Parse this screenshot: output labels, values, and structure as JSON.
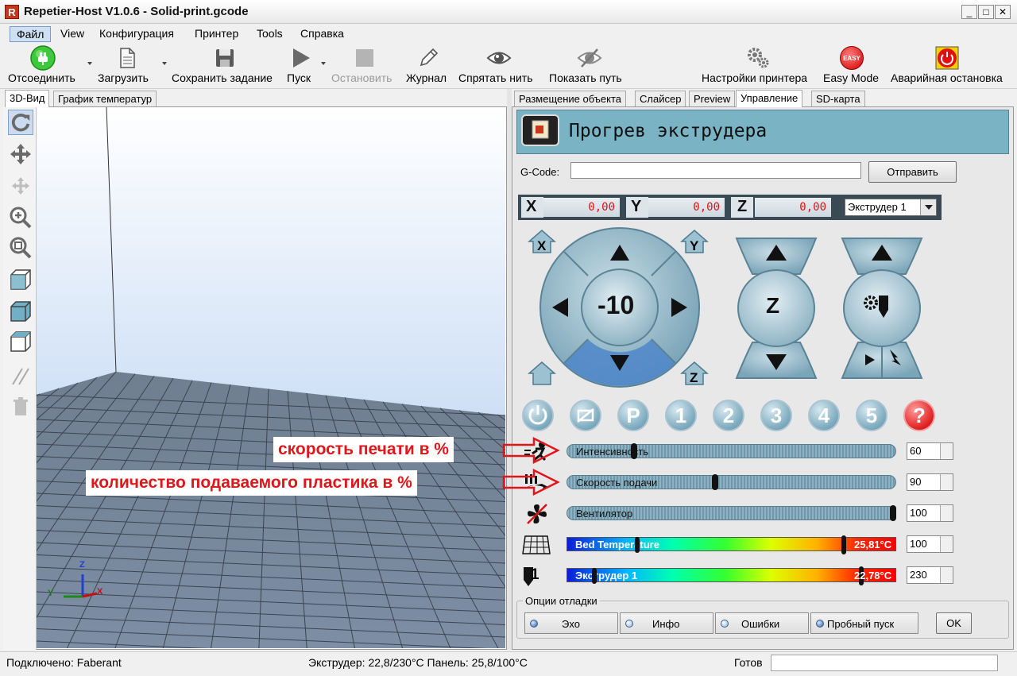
{
  "window": {
    "app_icon": "R",
    "title": "Repetier-Host V1.0.6 - Solid-print.gcode",
    "controls": {
      "minimize": "_",
      "maximize": "□",
      "close": "✕"
    }
  },
  "menu": [
    "Файл",
    "View",
    "Конфигурация",
    "Принтер",
    "Tools",
    "Справка"
  ],
  "toolbar": {
    "disconnect": "Отсоединить",
    "load": "Загрузить",
    "save_job": "Сохранить задание",
    "run": "Пуск",
    "stop": "Остановить",
    "log": "Журнал",
    "hide_filament": "Спрятать нить",
    "show_path": "Показать путь",
    "printer_settings": "Настройки принтера",
    "easy_mode": "Easy Mode",
    "easy_badge": "EASY",
    "emergency_stop": "Аварийная остановка"
  },
  "left_tabs": [
    "3D-Вид",
    "График температур"
  ],
  "right_tabs": [
    "Размещение объекта",
    "Слайсер",
    "Preview",
    "Управление",
    "SD-карта"
  ],
  "control": {
    "heading": "Прогрев экструдера",
    "gcode_label": "G-Code:",
    "gcode_value": "",
    "send_button": "Отправить",
    "x_label": "X",
    "x_value": "0,00",
    "y_label": "Y",
    "y_value": "0,00",
    "z_label": "Z",
    "z_value": "0,00",
    "extruder_select": "Экструдер 1",
    "jog_step": "-10",
    "z_label_big": "Z",
    "home_x": "X",
    "home_y": "Y",
    "home_z": "Z",
    "preset_buttons": [
      "P",
      "1",
      "2",
      "3",
      "4",
      "5",
      "?"
    ],
    "sliders": {
      "speed": {
        "label": "Интенсивность",
        "value": "60",
        "level": 60,
        "max": 300
      },
      "flow": {
        "label": "Скорость подачи",
        "value": "90",
        "level": 90,
        "max": 200
      },
      "fan": {
        "label": "Вентилятор",
        "value": "100",
        "level": 100,
        "max": 100
      }
    },
    "bed": {
      "label": "Bed Temperature",
      "current": "25,81°C",
      "target": "100"
    },
    "extruder": {
      "label": "Экструдер 1",
      "current": "22,78°C",
      "target": "230",
      "row_number": "1"
    },
    "debug": {
      "title": "Опции отладки",
      "echo": "Эхо",
      "info": "Инфо",
      "errors": "Ошибки",
      "dry_run": "Пробный пуск",
      "ok": "OK"
    }
  },
  "annotations": {
    "speed_note": "скорость печати в %",
    "flow_note": "количество подаваемого пластика в %"
  },
  "status": {
    "connected": "Подключено: Faberant",
    "temps": "Экструдер: 22,8/230°C Панель: 25,8/100°C",
    "ready": "Готов"
  },
  "axis_gizmo": {
    "x": "X",
    "y": "Y",
    "z": "Z"
  }
}
